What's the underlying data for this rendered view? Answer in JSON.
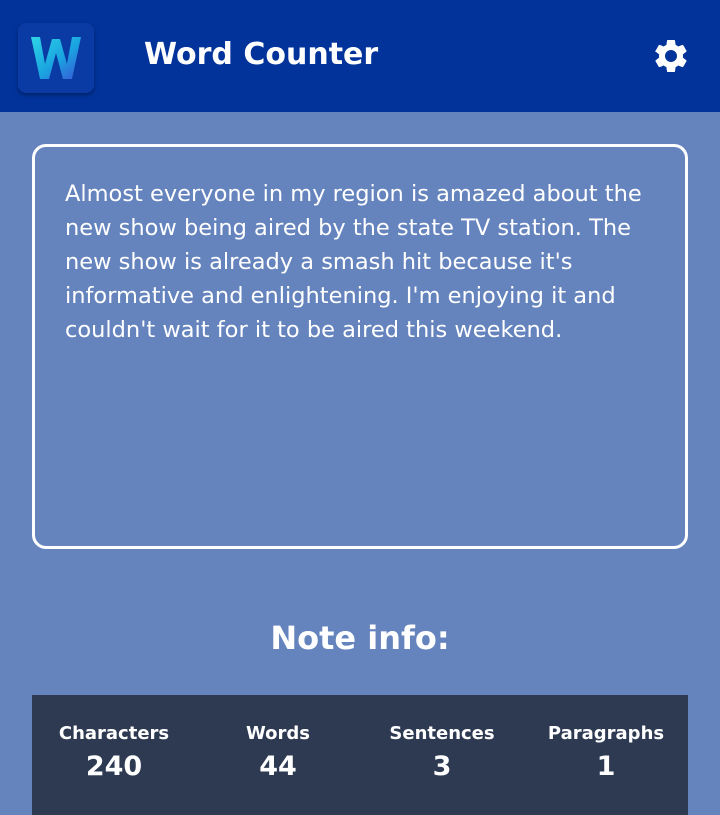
{
  "app_bar": {
    "title": "Word Counter",
    "logo_icon": "w-logo-icon",
    "settings_icon": "gear-icon",
    "background": "#01339b"
  },
  "note": {
    "text": "Almost everyone in my region is amazed about the new show being aired by the state TV station. The new show is already a smash hit because it's informative and enlightening. I'm enjoying it and couldn't wait for it to be aired this weekend."
  },
  "note_info": {
    "title": "Note info:",
    "stats": [
      {
        "label": "Characters",
        "value": "240"
      },
      {
        "label": "Words",
        "value": "44"
      },
      {
        "label": "Sentences",
        "value": "3"
      },
      {
        "label": "Paragraphs",
        "value": "1"
      }
    ]
  },
  "colors": {
    "page_background": "#6584bd",
    "stats_background": "#2d3a52",
    "text": "#ffffff"
  }
}
